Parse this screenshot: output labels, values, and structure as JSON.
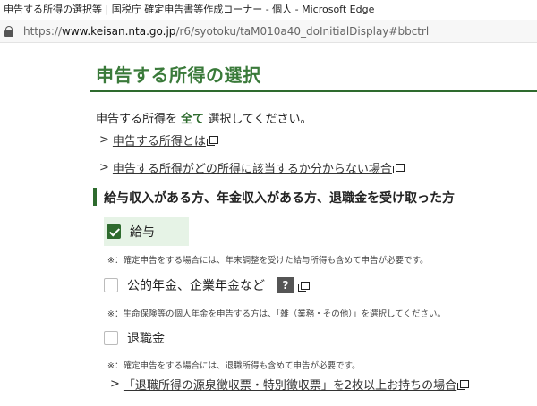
{
  "window": {
    "title": "申告する所得の選択等 | 国税庁 確定申告書等作成コーナー - 個人 - Microsoft Edge"
  },
  "address": {
    "scheme": "https://",
    "host": "www.keisan.nta.go.jp",
    "path": "/r6/syotoku/taM010a40_doInitialDisplay#bbctrl"
  },
  "page": {
    "heading": "申告する所得の選択",
    "intro_before": "申告する所得を",
    "intro_em": "全て",
    "intro_after": "選択してください。",
    "links": [
      {
        "label": "申告する所得とは"
      },
      {
        "label": "申告する所得がどの所得に該当するか分からない場合"
      }
    ],
    "section_title": "給与収入がある方、年金収入がある方、退職金を受け取った方",
    "options": [
      {
        "label": "給与",
        "checked": true,
        "note": "※：確定申告をする場合には、年末調整を受けた給与所得も含めて申告が必要です。"
      },
      {
        "label": "公的年金、企業年金など",
        "checked": false,
        "help": "?",
        "note": "※：生命保険等の個人年金を申告する方は、「雑（業務・その他）」を選択してください。"
      },
      {
        "label": "退職金",
        "checked": false,
        "note": "※：確定申告をする場合には、退職所得も含めて申告が必要です。"
      }
    ],
    "bottom_link": "「退職所得の源泉徴収票・特別徴収票」を2枚以上お持ちの場合"
  },
  "colors": {
    "accent": "#2e6b2e",
    "heading": "#3a7a3a",
    "checked_bg": "#e6f3e6"
  }
}
